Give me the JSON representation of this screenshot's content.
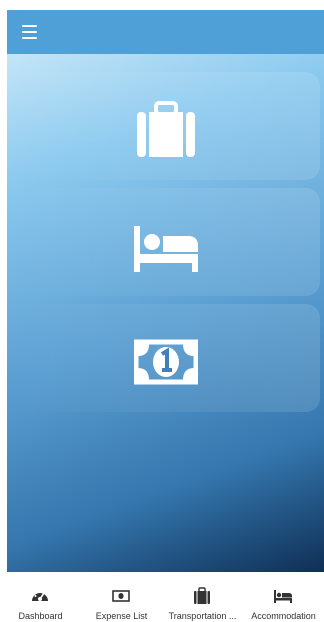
{
  "app_bar": {
    "menu_icon": "hamburger-menu-icon",
    "color": "#4fa0d7"
  },
  "main": {
    "cards": [
      {
        "icon": "suitcase-icon"
      },
      {
        "icon": "bed-icon"
      },
      {
        "icon": "money-bill-icon"
      }
    ]
  },
  "bottom_nav": {
    "items": [
      {
        "label": "Dashboard",
        "icon": "tachometer-icon"
      },
      {
        "label": "Expense List",
        "icon": "money-bill-icon"
      },
      {
        "label": "Transportation ...",
        "icon": "suitcase-icon"
      },
      {
        "label": "Accommodation",
        "icon": "bed-icon"
      }
    ]
  }
}
